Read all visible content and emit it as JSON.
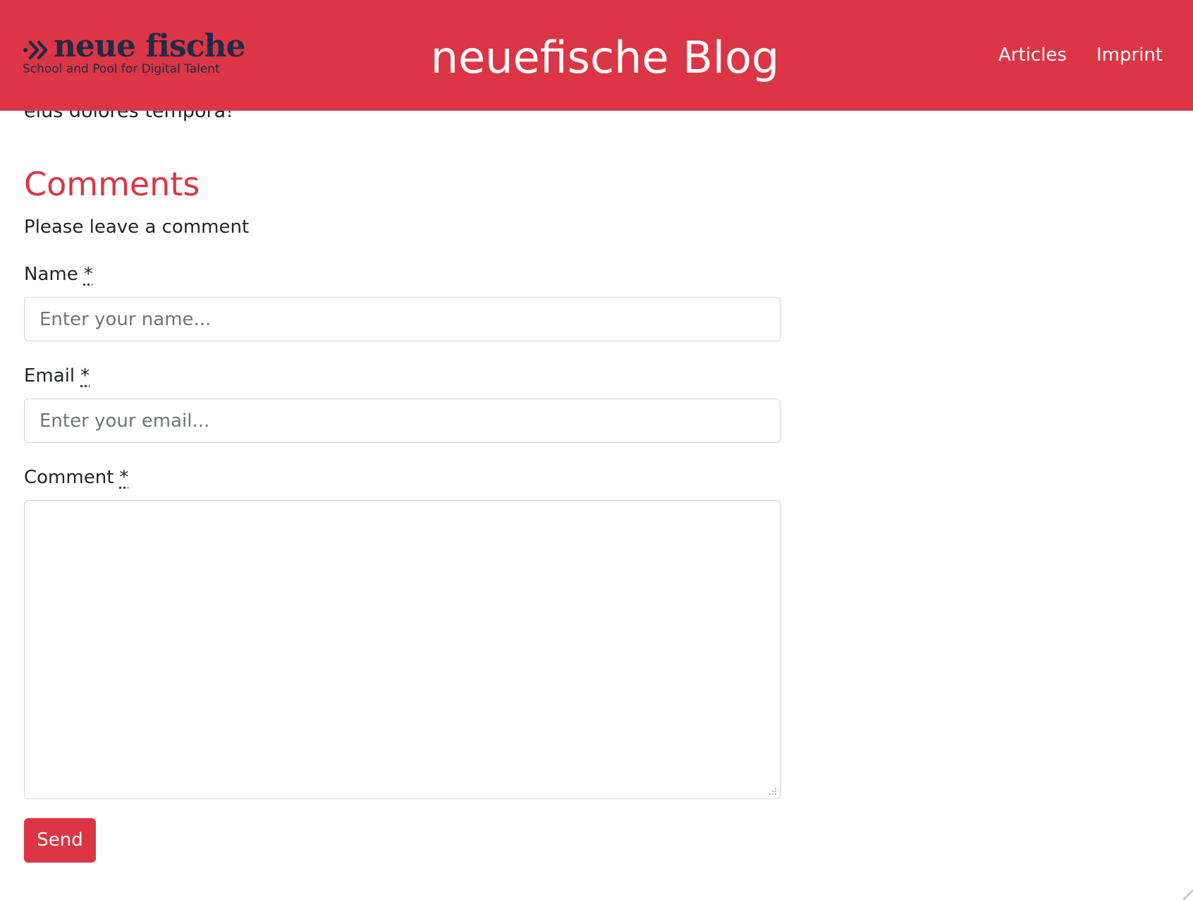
{
  "header": {
    "brand": {
      "name": "neue fische",
      "tagline": "School and Pool for Digital Talent"
    },
    "site_title": "neuefische Blog",
    "nav": [
      {
        "label": "Articles"
      },
      {
        "label": "Imprint"
      }
    ]
  },
  "article": {
    "trailing_text": "eius dolores tempora!"
  },
  "comments": {
    "heading": "Comments",
    "intro": "Please leave a comment",
    "form": {
      "name": {
        "label": "Name",
        "required_marker": "*",
        "placeholder": "Enter your name...",
        "value": ""
      },
      "email": {
        "label": "Email",
        "required_marker": "*",
        "placeholder": "Enter your email...",
        "value": ""
      },
      "comment": {
        "label": "Comment",
        "required_marker": "*",
        "value": ""
      },
      "submit_label": "Send"
    }
  },
  "colors": {
    "accent": "#dc3545",
    "brand_text": "#1e2b47",
    "header_text": "#ffffff",
    "body_text": "#212529",
    "input_border": "#ced4da",
    "placeholder": "#6c757d"
  },
  "icons": {
    "brand_mark": "double-chevron-right-icon",
    "textarea_resize": "resize-handle-icon",
    "window_resize": "window-resize-grip-icon"
  }
}
